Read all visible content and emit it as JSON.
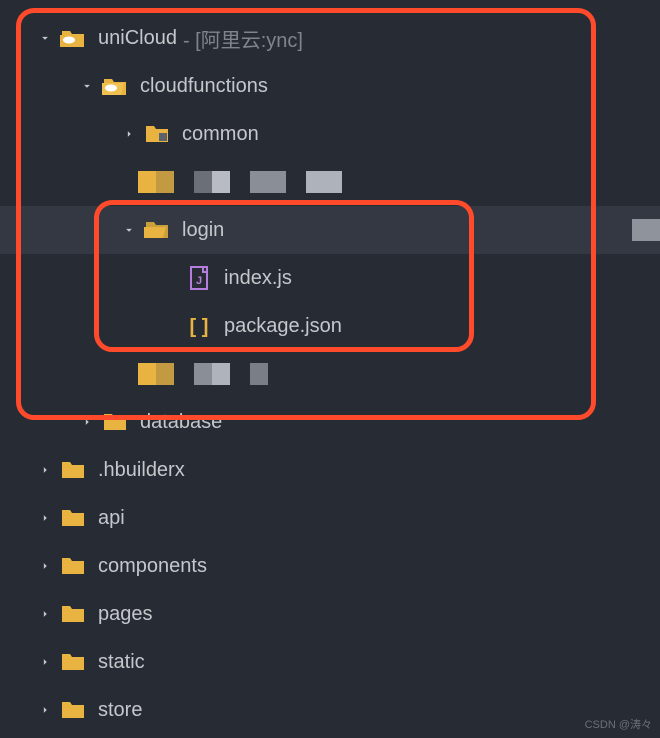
{
  "tree": {
    "root": {
      "label": "uniCloud",
      "suffix": "- [阿里云:ync]"
    },
    "cloudfunctions": {
      "label": "cloudfunctions"
    },
    "common": {
      "label": "common"
    },
    "login": {
      "label": "login"
    },
    "indexjs": {
      "label": "index.js"
    },
    "packagejson": {
      "label": "package.json"
    },
    "database": {
      "label": "database"
    },
    "hbuilderx": {
      "label": ".hbuilderx"
    },
    "api": {
      "label": "api"
    },
    "components": {
      "label": "components"
    },
    "pages": {
      "label": "pages"
    },
    "static": {
      "label": "static"
    },
    "store": {
      "label": "store"
    }
  },
  "watermark": "CSDN @涛々"
}
